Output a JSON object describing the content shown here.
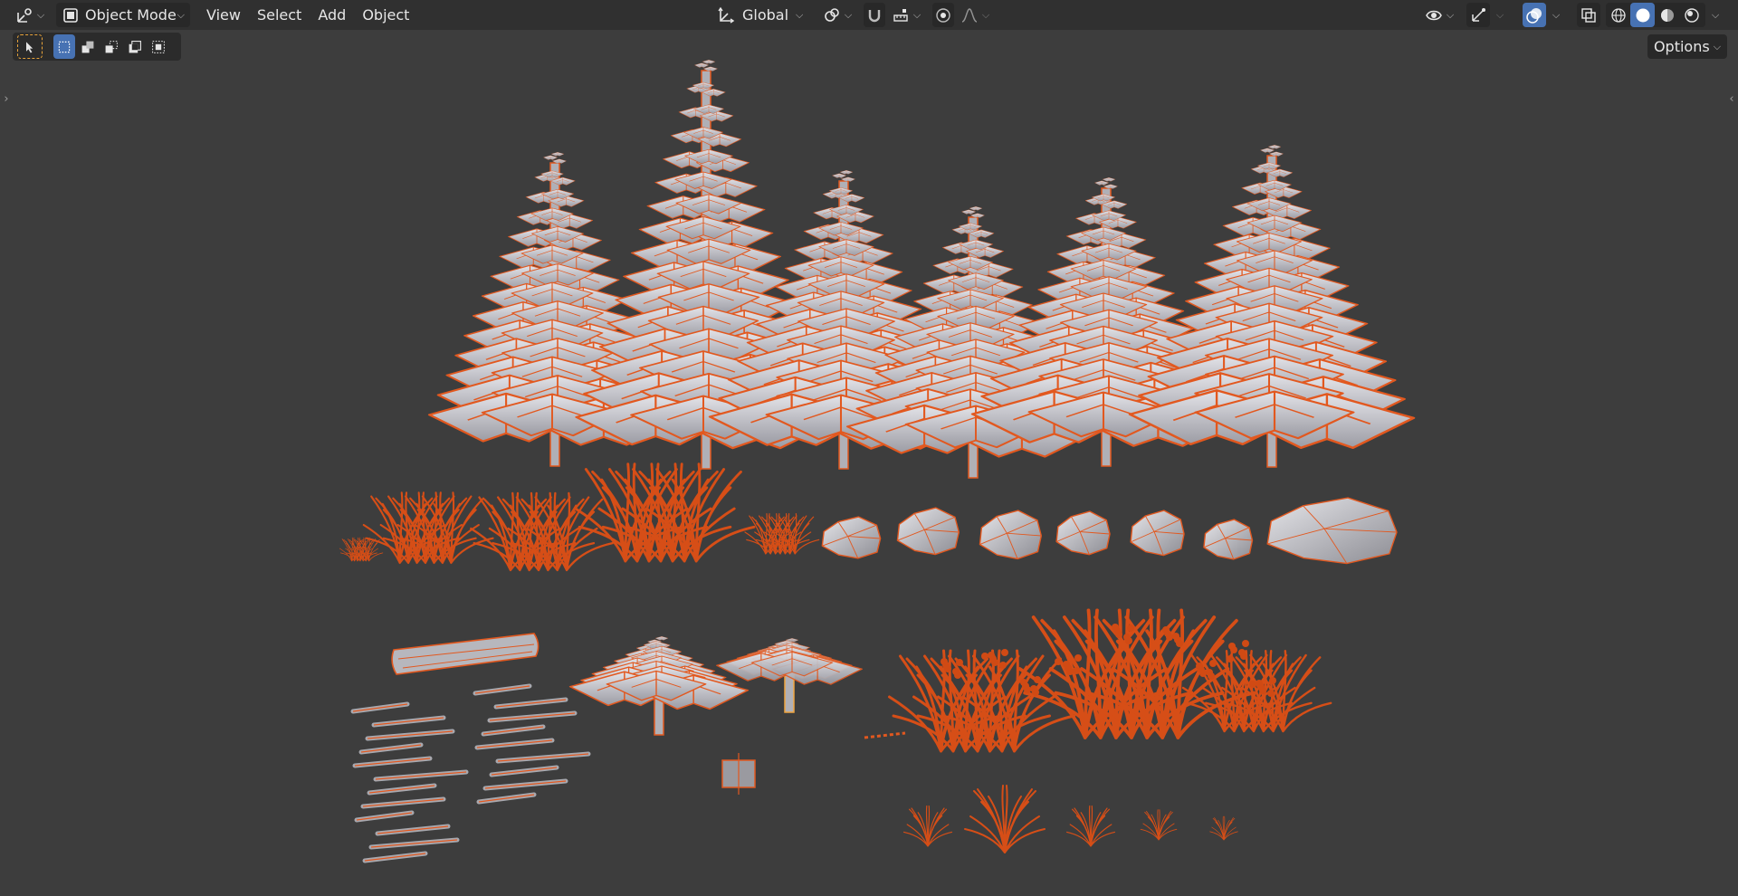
{
  "header": {
    "mode_label": "Object Mode",
    "menus": [
      "View",
      "Select",
      "Add",
      "Object"
    ],
    "transform_orientation": "Global",
    "options_label": "Options"
  },
  "colors": {
    "background": "#3d3d3d",
    "header": "#303030",
    "accent": "#4772b3",
    "selection_outline": "#e2581f",
    "active_outline": "#f0a540",
    "mesh_fill": "#c7c7cc"
  },
  "scene": {
    "selected_objects": "all",
    "objects": [
      "pine-tree-1",
      "pine-tree-2",
      "pine-tree-3",
      "pine-tree-4",
      "pine-tree-5",
      "pine-tree-6",
      "grass-clump-small",
      "bush-1",
      "bush-2",
      "bush-3",
      "twig-1",
      "rock-1",
      "rock-2",
      "rock-3",
      "rock-4",
      "rock-5",
      "rock-6",
      "rock-large",
      "log",
      "sticks-left",
      "sticks-right",
      "small-pine",
      "small-pine-active",
      "empty-cube",
      "leafy-bush-1",
      "leafy-bush-2",
      "leafy-bush-3",
      "dry-twigs-row"
    ]
  }
}
